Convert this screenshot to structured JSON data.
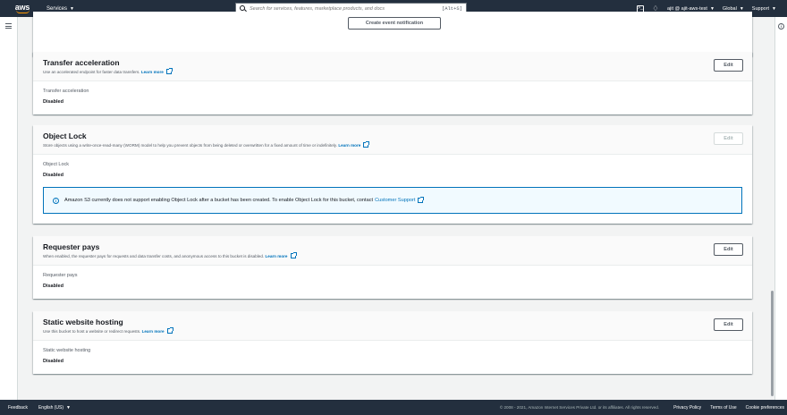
{
  "topnav": {
    "logo_text": "aws",
    "services_label": "Services",
    "search_placeholder": "Search for services, features, marketplace products, and docs",
    "search_shortcut": "[Alt+S]",
    "account_label": "ajit @ ajit-aws-test",
    "region_label": "Global",
    "support_label": "Support"
  },
  "top_panel": {
    "create_event_button": "Create event notification"
  },
  "transfer_acceleration": {
    "title": "Transfer acceleration",
    "description": "Use an accelerated endpoint for faster data transfers.",
    "learn_more": "Learn more",
    "edit_button": "Edit",
    "field_label": "Transfer acceleration",
    "field_value": "Disabled"
  },
  "object_lock": {
    "title": "Object Lock",
    "description": "Store objects using a write-once-read-many (WORM) model to help you prevent objects from being deleted or overwritten for a fixed amount of time or indefinitely.",
    "learn_more": "Learn more",
    "edit_button": "Edit",
    "field_label": "Object Lock",
    "field_value": "Disabled",
    "alert_text": "Amazon S3 currently does not support enabling Object Lock after a bucket has been created. To enable Object Lock for this bucket, contact",
    "alert_link": "Customer Support"
  },
  "requester_pays": {
    "title": "Requester pays",
    "description": "When enabled, the requester pays for requests and data transfer costs, and anonymous access to this bucket is disabled.",
    "learn_more": "Learn more",
    "edit_button": "Edit",
    "field_label": "Requester pays",
    "field_value": "Disabled"
  },
  "static_website_hosting": {
    "title": "Static website hosting",
    "description": "Use this bucket to host a website or redirect requests.",
    "learn_more": "Learn more",
    "edit_button": "Edit",
    "field_label": "Static website hosting",
    "field_value": "Disabled"
  },
  "footer": {
    "feedback": "Feedback",
    "language": "English (US)",
    "copyright": "© 2008 - 2021, Amazon Internet Services Private Ltd. or its affiliates. All rights reserved.",
    "privacy": "Privacy Policy",
    "terms": "Terms of Use",
    "cookies": "Cookie preferences"
  },
  "colors": {
    "nav_bg": "#232f3e",
    "accent": "#ff9900",
    "link": "#0073bb",
    "page_bg": "#f2f3f3"
  }
}
